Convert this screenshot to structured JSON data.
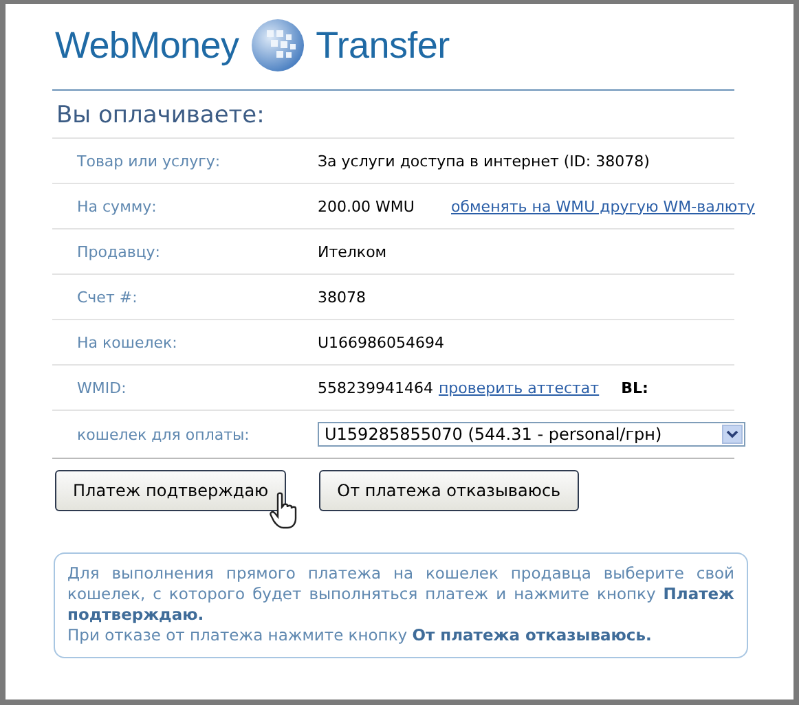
{
  "header": {
    "brand_left": "WebMoney",
    "brand_right": "Transfer"
  },
  "heading": "Вы оплачиваете:",
  "rows": [
    {
      "kind": "text",
      "label": "Товар или услугу:",
      "value": "За услуги доступа в интернет (ID: 38078)"
    },
    {
      "kind": "link",
      "label": "На сумму:",
      "value": "200.00 WMU",
      "link": "обменять на WMU другую WM-валюту"
    },
    {
      "kind": "text",
      "label": "Продавцу:",
      "value": "Ителком"
    },
    {
      "kind": "text",
      "label": "Счет #:",
      "value": "38078"
    },
    {
      "kind": "text",
      "label": "На кошелек:",
      "value": "U166986054694"
    },
    {
      "kind": "wmid",
      "label": "WMID:",
      "value": "558239941464",
      "link": "проверить аттестат",
      "badge": "BL:"
    },
    {
      "kind": "select",
      "label": "кошелек для оплаты:",
      "value": "U159285855070 (544.31 - personal/грн)"
    }
  ],
  "buttons": [
    {
      "label": "Платеж подтверждаю",
      "hovered": true
    },
    {
      "label": "От платежа отказываюсь",
      "hovered": false
    }
  ],
  "info": [
    "Для выполнения прямого платежа на кошелек продавца выберите свой кошелек, с которого будет выполняться платеж и нажмите кнопку **Платеж подтверждаю.**",
    "При отказе от платежа нажмите кнопку **От платежа отказываюсь.**"
  ]
}
